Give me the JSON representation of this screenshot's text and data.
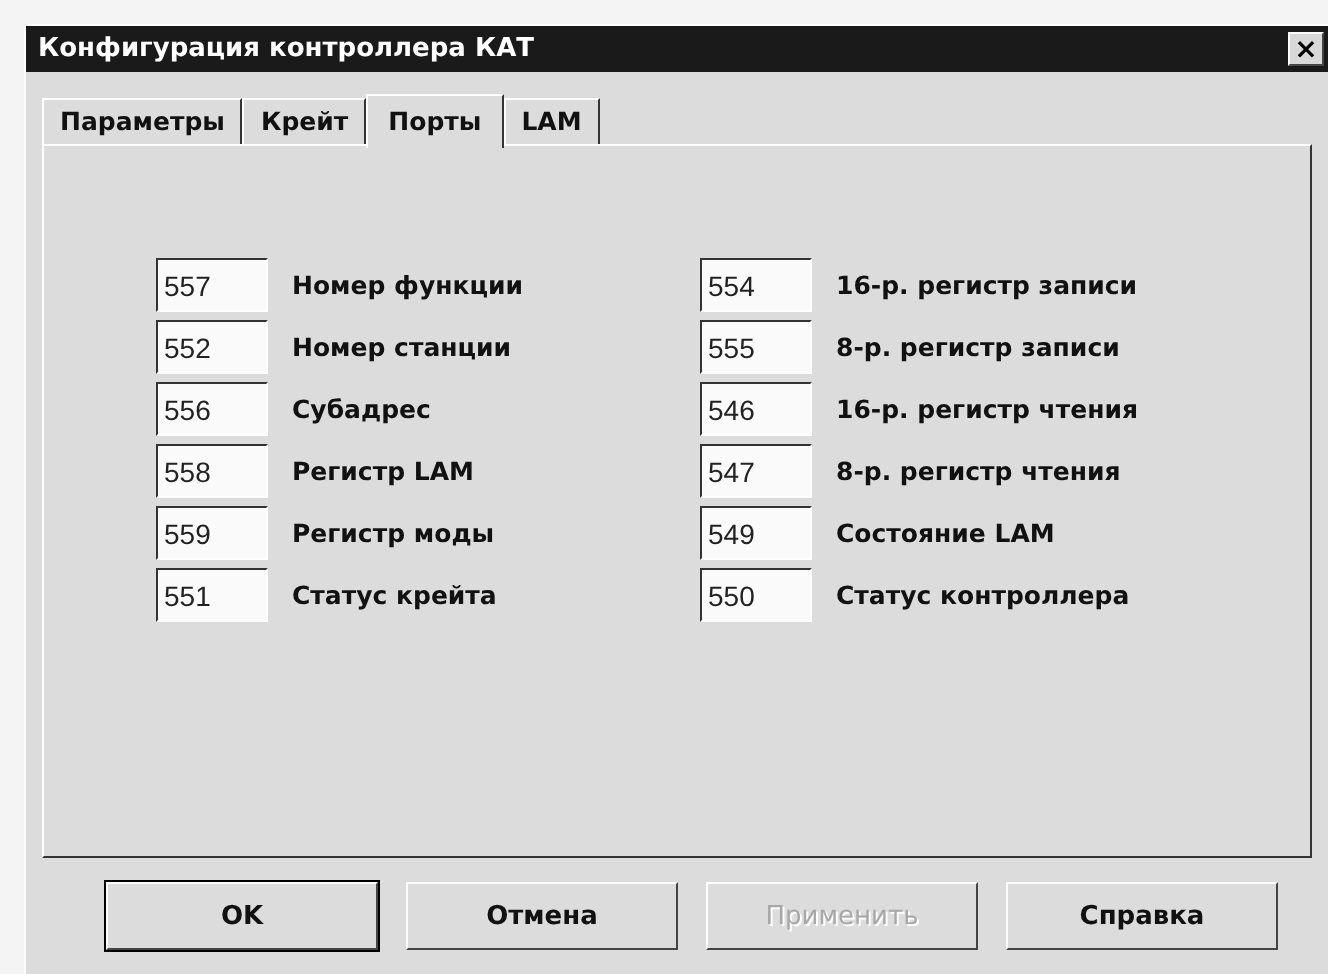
{
  "window": {
    "title": "Конфигурация контроллера КАТ",
    "close": "×"
  },
  "tabs": [
    {
      "label": "Параметры",
      "selected": false
    },
    {
      "label": "Крейт",
      "selected": false
    },
    {
      "label": "Порты",
      "selected": true
    },
    {
      "label": "LAM",
      "selected": false
    }
  ],
  "columns": [
    {
      "fields": [
        {
          "value": "557",
          "label": "Номер функции"
        },
        {
          "value": "552",
          "label": "Номер станции"
        },
        {
          "value": "556",
          "label": "Субадрес"
        },
        {
          "value": "558",
          "label": "Регистр LAM"
        },
        {
          "value": "559",
          "label": "Регистр моды"
        },
        {
          "value": "551",
          "label": "Статус крейта"
        }
      ]
    },
    {
      "fields": [
        {
          "value": "554",
          "label": "16-р. регистр записи"
        },
        {
          "value": "555",
          "label": "8-р. регистр записи"
        },
        {
          "value": "546",
          "label": "16-р. регистр чтения"
        },
        {
          "value": "547",
          "label": "8-р. регистр чтения"
        },
        {
          "value": "549",
          "label": "Состояние LAM"
        },
        {
          "value": "550",
          "label": "Статус контроллера"
        }
      ]
    }
  ],
  "buttons": [
    {
      "label": "OK",
      "default": true,
      "disabled": false
    },
    {
      "label": "Отмена",
      "default": false,
      "disabled": false
    },
    {
      "label": "Применить",
      "default": false,
      "disabled": true
    },
    {
      "label": "Справка",
      "default": false,
      "disabled": false
    }
  ]
}
